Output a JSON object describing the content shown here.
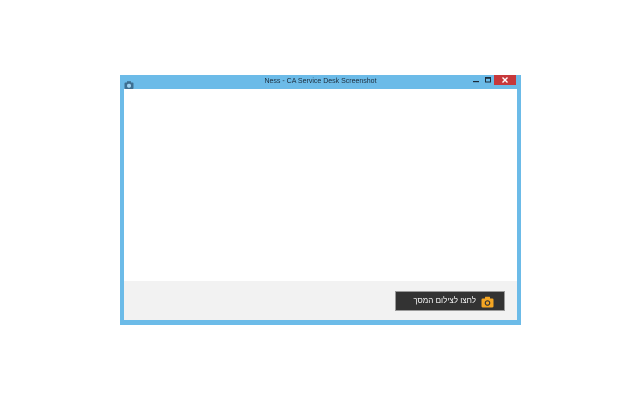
{
  "window": {
    "title": "Ness - CA Service Desk Screenshot"
  },
  "footer": {
    "capture_button_label": "לחצו לצילום המסך"
  },
  "colors": {
    "window_frame": "#6cbbe8",
    "close_button": "#c7383b",
    "button_bg": "#333333",
    "camera_icon": "#f5a623",
    "footer_bg": "#f2f2f2"
  }
}
